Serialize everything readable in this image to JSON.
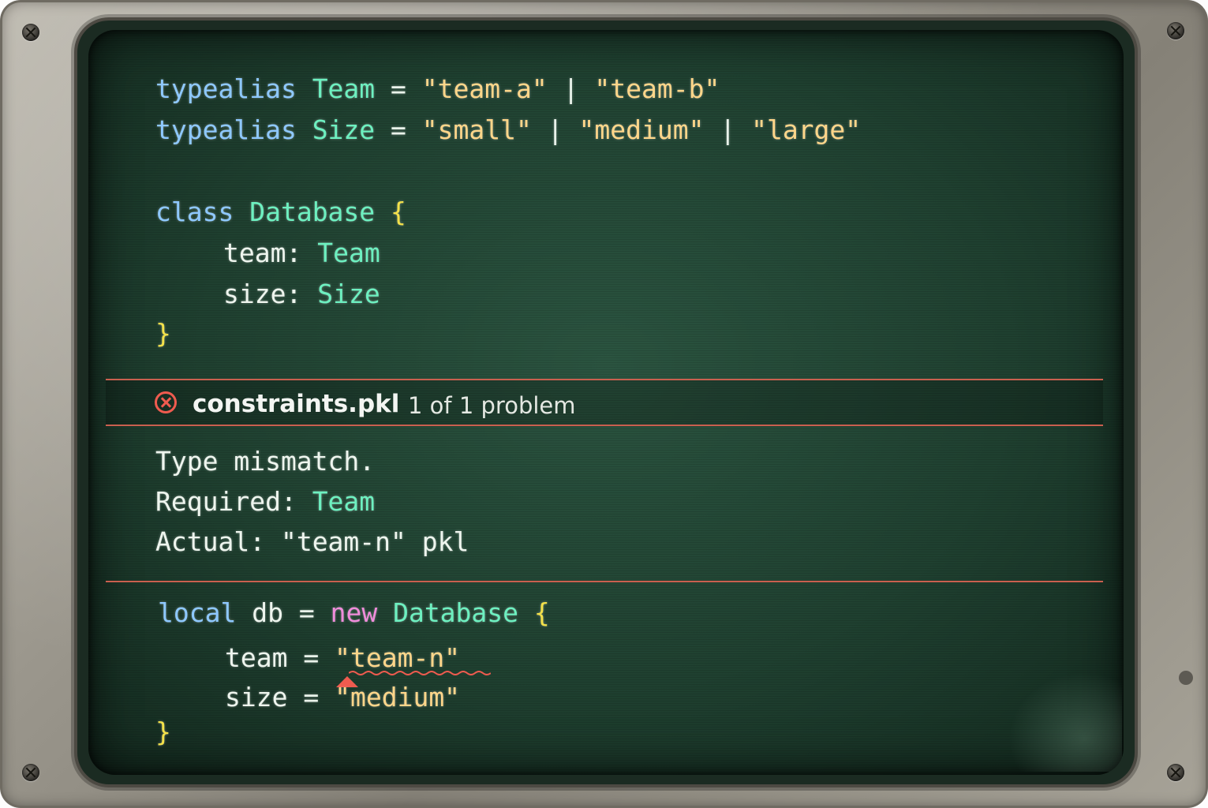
{
  "editor": {
    "line1": {
      "kw": "typealias",
      "name": "Team",
      "eq": "=",
      "s1": "\"team-a\"",
      "pipe1": "|",
      "s2": "\"team-b\""
    },
    "line2": {
      "kw": "typealias",
      "name": "Size",
      "eq": "=",
      "s1": "\"small\"",
      "pipe1": "|",
      "s2": "\"medium\"",
      "pipe2": "|",
      "s3": "\"large\""
    },
    "class_decl": {
      "kw": "class",
      "name": "Database",
      "open": "{"
    },
    "field1": {
      "name": "team:",
      "type": "Team"
    },
    "field2": {
      "name": "size:",
      "type": "Size"
    },
    "class_close": "}",
    "local_decl": {
      "kw": "local",
      "name": "db",
      "eq": "=",
      "new": "new",
      "type": "Database",
      "open": "{"
    },
    "assign1": {
      "name": "team",
      "eq": "=",
      "value": "\"team-n\""
    },
    "assign2": {
      "name": "size",
      "eq": "=",
      "value": "\"medium\""
    },
    "local_close": "}"
  },
  "problem": {
    "file": "constraints.pkl",
    "count": "1 of 1 problem",
    "icon": "error-circle-icon",
    "line1": "Type mismatch.",
    "required_label": "Required:",
    "required_type": "Team",
    "actual_label": "Actual:",
    "actual_value": "\"team-n\" pkl"
  },
  "colors": {
    "screen": "#1f4030",
    "keyword": "#8ec8ff",
    "type": "#6df0c0",
    "string": "#ffd68a",
    "brace": "#f3e14a",
    "error": "#ef5b4f"
  }
}
